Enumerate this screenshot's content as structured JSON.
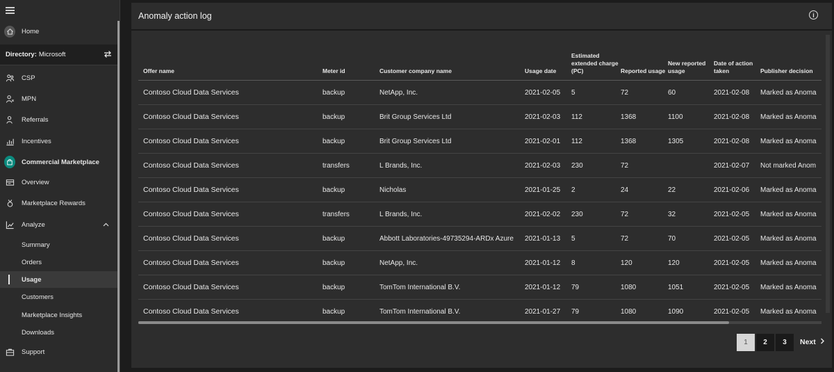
{
  "sidebar": {
    "home": "Home",
    "directory_label": "Directory:",
    "directory_value": "Microsoft",
    "items": [
      {
        "label": "CSP",
        "icon": "csp-icon"
      },
      {
        "label": "MPN",
        "icon": "mpn-icon"
      },
      {
        "label": "Referrals",
        "icon": "referrals-icon"
      },
      {
        "label": "Incentives",
        "icon": "incentives-icon"
      },
      {
        "label": "Commercial Marketplace",
        "icon": "marketplace-bag-icon"
      },
      {
        "label": "Overview",
        "icon": "overview-icon"
      },
      {
        "label": "Marketplace Rewards",
        "icon": "rewards-icon"
      },
      {
        "label": "Analyze",
        "icon": "analyze-chart-icon"
      }
    ],
    "analyze_sub": [
      "Summary",
      "Orders",
      "Usage",
      "Customers",
      "Marketplace Insights",
      "Downloads"
    ],
    "active_sub": "Usage",
    "support": "Support"
  },
  "panel": {
    "title": "Anomaly action log",
    "columns": [
      "Offer name",
      "Meter id",
      "Customer company name",
      "Usage date",
      "Estimated extended charge (PC)",
      "Reported usage",
      "New reported usage",
      "Date of action taken",
      "Publisher decision"
    ],
    "rows": [
      [
        "Contoso Cloud Data Services",
        "backup",
        "NetApp, Inc.",
        "2021-02-05",
        "5",
        "72",
        "60",
        "2021-02-08",
        "Marked as Anoma"
      ],
      [
        "Contoso Cloud Data Services",
        "backup",
        "Brit Group Services Ltd",
        "2021-02-03",
        "112",
        "1368",
        "1100",
        "2021-02-08",
        "Marked as Anoma"
      ],
      [
        "Contoso Cloud Data Services",
        "backup",
        "Brit Group Services Ltd",
        "2021-02-01",
        "112",
        "1368",
        "1305",
        "2021-02-08",
        "Marked as Anoma"
      ],
      [
        "Contoso Cloud Data Services",
        "transfers",
        "L Brands, Inc.",
        "2021-02-03",
        "230",
        "72",
        "",
        "2021-02-07",
        "Not marked Anom"
      ],
      [
        "Contoso Cloud Data Services",
        "backup",
        "Nicholas",
        "2021-01-25",
        "2",
        "24",
        "22",
        "2021-02-06",
        "Marked as Anoma"
      ],
      [
        "Contoso Cloud Data Services",
        "transfers",
        "L Brands, Inc.",
        "2021-02-02",
        "230",
        "72",
        "32",
        "2021-02-05",
        "Marked as Anoma"
      ],
      [
        "Contoso Cloud Data Services",
        "backup",
        "Abbott Laboratories-49735294-ARDx Azure",
        "2021-01-13",
        "5",
        "72",
        "70",
        "2021-02-05",
        "Marked as Anoma"
      ],
      [
        "Contoso Cloud Data Services",
        "backup",
        "NetApp, Inc.",
        "2021-01-12",
        "8",
        "120",
        "120",
        "2021-02-05",
        "Marked as Anoma"
      ],
      [
        "Contoso Cloud Data Services",
        "backup",
        "TomTom International B.V.",
        "2021-01-12",
        "79",
        "1080",
        "1051",
        "2021-02-05",
        "Marked as Anoma"
      ],
      [
        "Contoso Cloud Data Services",
        "backup",
        "TomTom International B.V.",
        "2021-01-27",
        "79",
        "1080",
        "1090",
        "2021-02-05",
        "Marked as Anoma"
      ]
    ],
    "pagination": {
      "pages": [
        "1",
        "2",
        "3"
      ],
      "current": "1",
      "next": "Next"
    }
  },
  "colors": {
    "accent_teal": "#0b8a7e",
    "panel_bg": "#2d2d2d",
    "sidebar_bg": "#2b2b2b"
  }
}
